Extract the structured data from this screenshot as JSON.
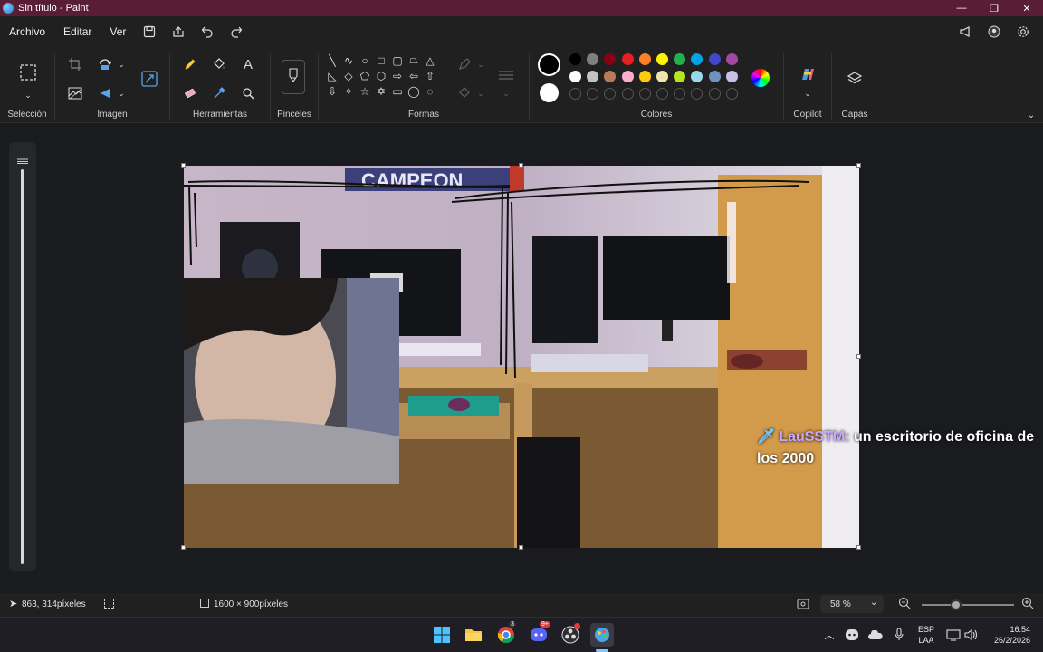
{
  "window": {
    "title": "Sin título - Paint",
    "minimize_glyph": "—",
    "restore_glyph": "❐",
    "close_glyph": "✕"
  },
  "menu": {
    "items": [
      "Archivo",
      "Editar",
      "Ver"
    ]
  },
  "ribbon": {
    "groups": {
      "seleccion": "Selección",
      "imagen": "Imagen",
      "herramientas": "Herramientas",
      "pinceles": "Pinceles",
      "formas": "Formas",
      "colores": "Colores",
      "copilot": "Copilot",
      "capas": "Capas"
    },
    "colors": {
      "primary": "#000000",
      "secondary": "#ffffff",
      "row1": [
        "#000000",
        "#7f7f7f",
        "#880015",
        "#ed1c24",
        "#ff7f27",
        "#fff200",
        "#22b14c",
        "#00a2e8",
        "#3f48cc",
        "#a349a4"
      ],
      "row2": [
        "#ffffff",
        "#c3c3c3",
        "#b97a57",
        "#ffaec9",
        "#ffc90e",
        "#efe4b0",
        "#b5e61d",
        "#99d9ea",
        "#7092be",
        "#c8bfe7"
      ]
    }
  },
  "canvas": {
    "chat_user": "LauSSTM:",
    "chat_message": "un escritorio de oficina de los 2000",
    "poster_text": "CAMPEON"
  },
  "status": {
    "cursor_position": "863, 314píxeles",
    "canvas_size": "1600 × 900píxeles",
    "zoom": "58 %",
    "zoom_level": 0.58
  },
  "taskbar": {
    "language_top": "ESP",
    "language_bottom": "LAA",
    "time": "16:54",
    "date": "26/2/2026",
    "chrome_badge": "3",
    "discord_badge": "9+"
  }
}
